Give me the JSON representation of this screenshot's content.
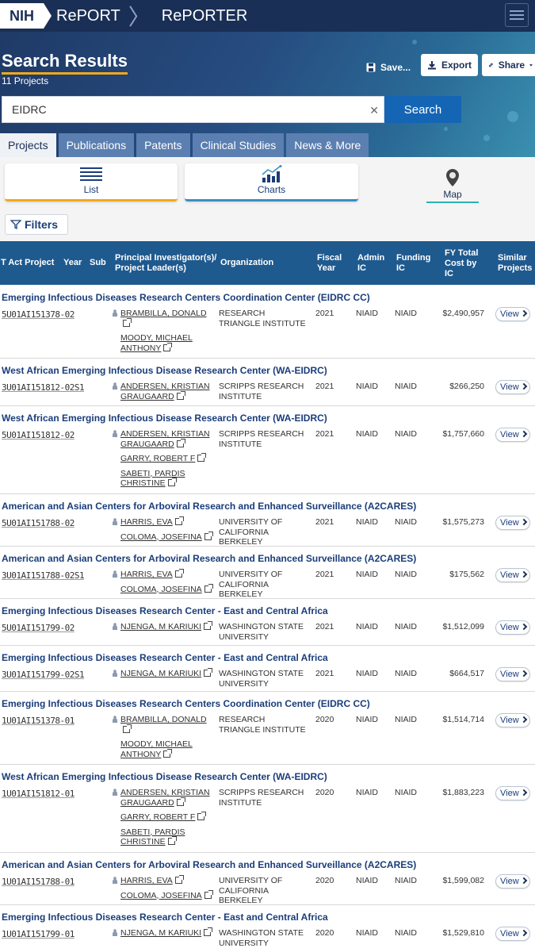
{
  "header": {
    "logo": "NIH",
    "app_name": "RePORT",
    "breadcrumb_sep": "〉",
    "section": "RePORTER"
  },
  "hero": {
    "title": "Search Results",
    "count": "11 Projects",
    "save_label": "Save...",
    "export_label": "Export",
    "share_label": "Share",
    "search_value": "EIDRC",
    "search_button": "Search"
  },
  "tabs": [
    {
      "label": "Projects",
      "active": true
    },
    {
      "label": "Publications"
    },
    {
      "label": "Patents"
    },
    {
      "label": "Clinical Studies"
    },
    {
      "label": "News & More"
    }
  ],
  "views": {
    "list": "List",
    "charts": "Charts",
    "map": "Map"
  },
  "filters_label": "Filters",
  "columns": {
    "c1": "T Act Project",
    "c2": "Year",
    "c3": "Sub",
    "c4": "Principal Investigator(s)/ Project Leader(s)",
    "c5": "Organization",
    "c6": "Fiscal Year",
    "c7": "Admin IC",
    "c8": "Funding IC",
    "c9": "FY Total Cost by IC",
    "c10": "Similar Projects"
  },
  "view_label": "View",
  "rows": [
    {
      "title": "Emerging Infectious Diseases Research Centers Coordination Center (EIDRC CC)",
      "number": "5U01AI151378-02",
      "pis": [
        "BRAMBILLA, DONALD",
        "MOODY, MICHAEL ANTHONY"
      ],
      "org": "RESEARCH TRIANGLE INSTITUTE",
      "fy": "2021",
      "admin": "NIAID",
      "funding": "NIAID",
      "cost": "$2,490,957"
    },
    {
      "title": "West African Emerging Infectious Disease Research Center (WA-EIDRC)",
      "number": "3U01AI151812-02S1",
      "pis": [
        "ANDERSEN, KRISTIAN GRAUGAARD"
      ],
      "org": "SCRIPPS RESEARCH INSTITUTE",
      "fy": "2021",
      "admin": "NIAID",
      "funding": "NIAID",
      "cost": "$266,250"
    },
    {
      "title": "West African Emerging Infectious Disease Research Center (WA-EIDRC)",
      "number": "5U01AI151812-02",
      "pis": [
        "ANDERSEN, KRISTIAN GRAUGAARD",
        "GARRY, ROBERT F",
        "SABETI, PARDIS CHRISTINE"
      ],
      "org": "SCRIPPS RESEARCH INSTITUTE",
      "fy": "2021",
      "admin": "NIAID",
      "funding": "NIAID",
      "cost": "$1,757,660"
    },
    {
      "title": "American and Asian Centers for Arboviral Research and Enhanced Surveillance (A2CARES)",
      "number": "5U01AI151788-02",
      "pis": [
        "HARRIS, EVA",
        "COLOMA, JOSEFINA"
      ],
      "org": "UNIVERSITY OF CALIFORNIA BERKELEY",
      "fy": "2021",
      "admin": "NIAID",
      "funding": "NIAID",
      "cost": "$1,575,273"
    },
    {
      "title": "American and Asian Centers for Arboviral Research and Enhanced Surveillance (A2CARES)",
      "number": "3U01AI151788-02S1",
      "pis": [
        "HARRIS, EVA",
        "COLOMA, JOSEFINA"
      ],
      "org": "UNIVERSITY OF CALIFORNIA BERKELEY",
      "fy": "2021",
      "admin": "NIAID",
      "funding": "NIAID",
      "cost": "$175,562"
    },
    {
      "title": "Emerging Infectious Diseases Research Center - East and Central Africa",
      "number": "5U01AI151799-02",
      "pis": [
        "NJENGA, M KARIUKI"
      ],
      "org": "WASHINGTON STATE UNIVERSITY",
      "fy": "2021",
      "admin": "NIAID",
      "funding": "NIAID",
      "cost": "$1,512,099"
    },
    {
      "title": "Emerging Infectious Diseases Research Center - East and Central Africa",
      "number": "3U01AI151799-02S1",
      "pis": [
        "NJENGA, M KARIUKI"
      ],
      "org": "WASHINGTON STATE UNIVERSITY",
      "fy": "2021",
      "admin": "NIAID",
      "funding": "NIAID",
      "cost": "$664,517"
    },
    {
      "title": "Emerging Infectious Diseases Research Centers Coordination Center (EIDRC CC)",
      "number": "1U01AI151378-01",
      "pis": [
        "BRAMBILLA, DONALD",
        "MOODY, MICHAEL ANTHONY"
      ],
      "org": "RESEARCH TRIANGLE INSTITUTE",
      "fy": "2020",
      "admin": "NIAID",
      "funding": "NIAID",
      "cost": "$1,514,714"
    },
    {
      "title": "West African Emerging Infectious Disease Research Center (WA-EIDRC)",
      "number": "1U01AI151812-01",
      "pis": [
        "ANDERSEN, KRISTIAN GRAUGAARD",
        "GARRY, ROBERT F",
        "SABETI, PARDIS CHRISTINE"
      ],
      "org": "SCRIPPS RESEARCH INSTITUTE",
      "fy": "2020",
      "admin": "NIAID",
      "funding": "NIAID",
      "cost": "$1,883,223"
    },
    {
      "title": "American and Asian Centers for Arboviral Research and Enhanced Surveillance (A2CARES)",
      "number": "1U01AI151788-01",
      "pis": [
        "HARRIS, EVA",
        "COLOMA, JOSEFINA"
      ],
      "org": "UNIVERSITY OF CALIFORNIA BERKELEY",
      "fy": "2020",
      "admin": "NIAID",
      "funding": "NIAID",
      "cost": "$1,599,082"
    },
    {
      "title": "Emerging Infectious Diseases Research Center - East and Central Africa",
      "number": "1U01AI151799-01",
      "pis": [
        "NJENGA, M KARIUKI"
      ],
      "org": "WASHINGTON STATE UNIVERSITY",
      "fy": "2020",
      "admin": "NIAID",
      "funding": "NIAID",
      "cost": "$1,529,810"
    }
  ],
  "colors": {
    "navy": "#1a2f55",
    "header_blue": "#1f5a8f",
    "accent_orange": "#f0a81c",
    "search_blue": "#1565b5",
    "link_blue": "#1a3d7a"
  }
}
